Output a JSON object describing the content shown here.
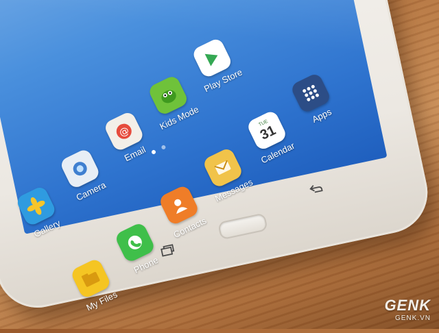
{
  "home_screen": {
    "apps": [
      {
        "label": "Gallery",
        "icon": "gallery-icon",
        "color": "#2f9be0"
      },
      {
        "label": "Camera",
        "icon": "camera-icon",
        "color": "#e8eef5"
      },
      {
        "label": "Email",
        "icon": "email-icon",
        "color": "#f3efe8"
      },
      {
        "label": "Kids Mode",
        "icon": "kids-mode-icon",
        "color": "#6fc23a"
      },
      {
        "label": "Play Store",
        "icon": "play-store-icon",
        "color": "#ffffff"
      },
      {
        "label": "My Files",
        "icon": "folder-icon",
        "color": "#f5c523"
      },
      {
        "label": "Phone",
        "icon": "phone-icon",
        "color": "#3fbf4a"
      },
      {
        "label": "Contacts",
        "icon": "contacts-icon",
        "color": "#ef7d28"
      },
      {
        "label": "Messages",
        "icon": "messages-icon",
        "color": "#f1c34a"
      },
      {
        "label": "Calendar",
        "icon": "calendar-icon",
        "color": "#ffffff"
      },
      {
        "label": "Apps",
        "icon": "apps-grid-icon",
        "color": "#2c4d86"
      }
    ],
    "calendar_icon": {
      "day": "TUE",
      "date": "31"
    },
    "page_indicator": {
      "pages": 2,
      "active": 1
    }
  },
  "watermark": {
    "brand": "GENK",
    "site": "GENK.VN"
  }
}
